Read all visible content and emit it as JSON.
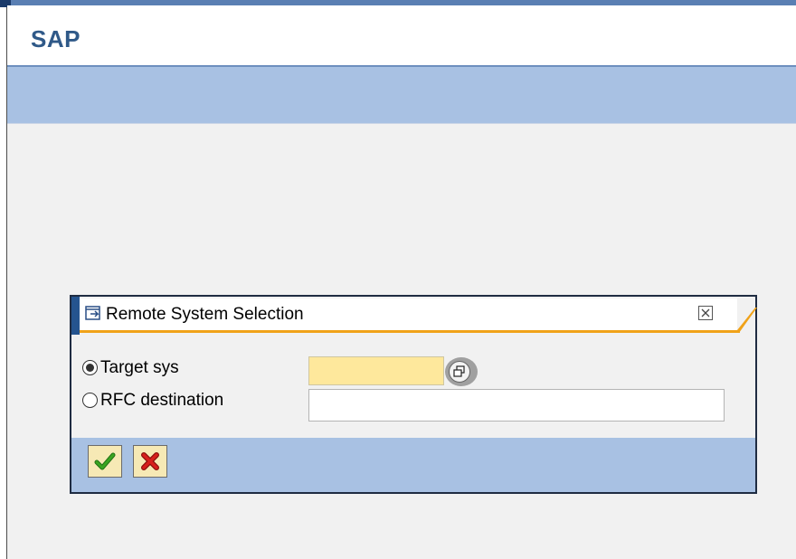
{
  "app": {
    "title": "SAP"
  },
  "dialog": {
    "title": "Remote System Selection",
    "title_icon": "window-arrow-icon",
    "close_icon": "close-icon",
    "options": [
      {
        "label": "Target sys",
        "selected": true,
        "value": "",
        "has_value_help": true
      },
      {
        "label": "RFC destination",
        "selected": false,
        "value": ""
      }
    ],
    "buttons": {
      "ok_icon": "checkmark-icon",
      "cancel_icon": "cancel-x-icon"
    }
  },
  "colors": {
    "brand_blue": "#2f5988",
    "toolbar_blue": "#a8c1e3",
    "required_field_yellow": "#fee89c",
    "dialog_accent_orange": "#f0a219",
    "ok_green": "#3aa521",
    "cancel_red": "#d8201c"
  }
}
